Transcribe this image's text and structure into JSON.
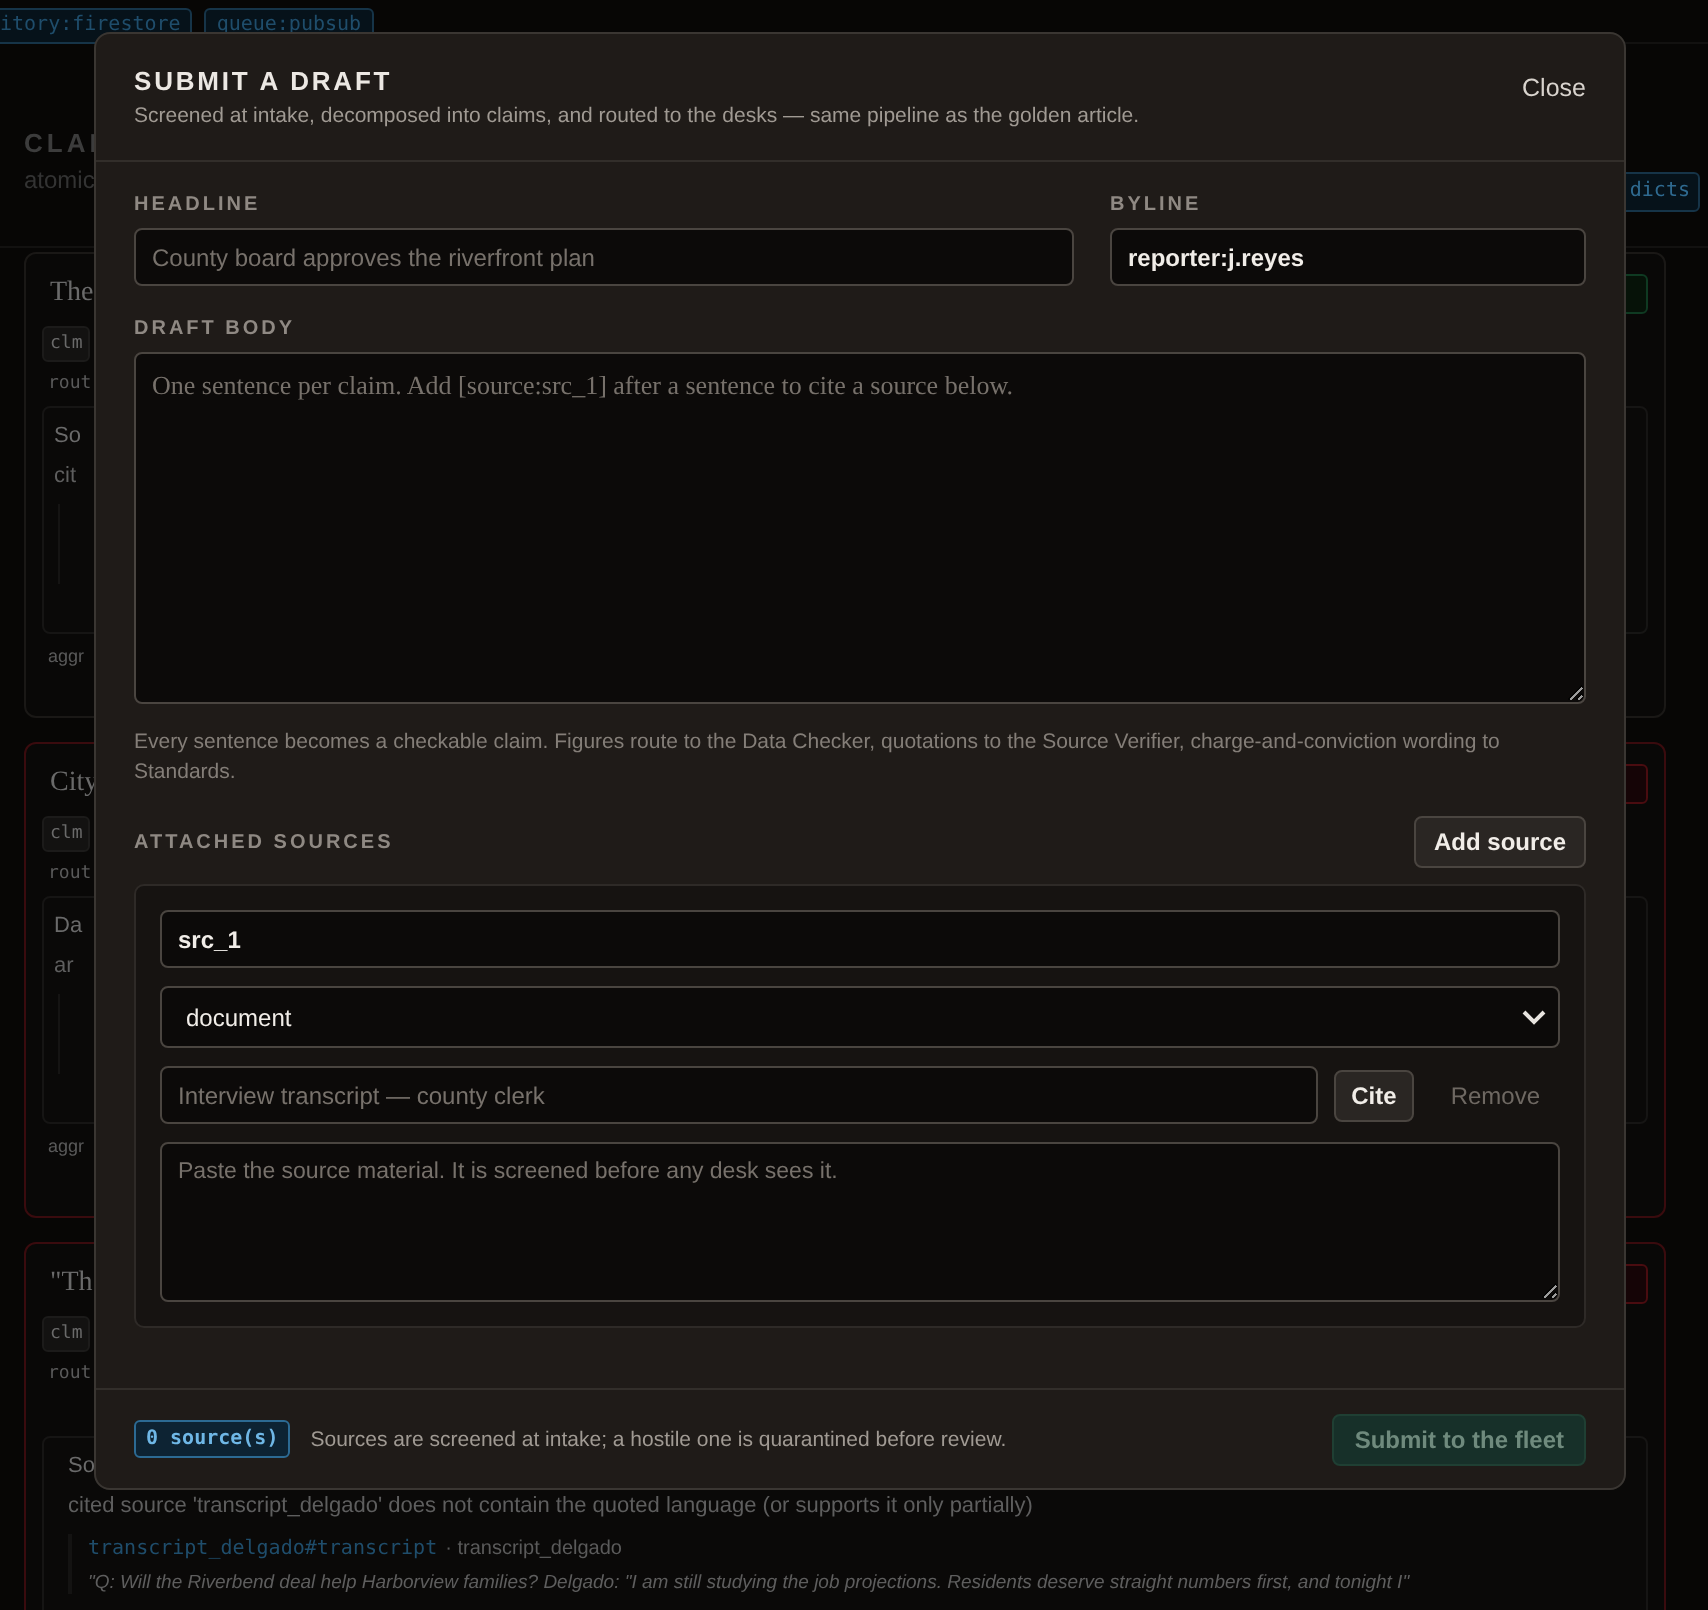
{
  "background": {
    "topbar_chips": [
      "itory:firestore",
      "queue:pubsub"
    ],
    "panel": {
      "title": "CLAI",
      "subtitle": "atomic",
      "chip": "dicts"
    },
    "cards": [
      {
        "title": "The",
        "tag": "clm",
        "route": "rout",
        "flagged": false,
        "block": {
          "title": "So",
          "lines": [
            "cit"
          ]
        },
        "footer": "aggr"
      },
      {
        "title": "City",
        "tag": "clm",
        "route": "rout",
        "flagged": true,
        "block": {
          "title": "Da",
          "lines": [
            "ar"
          ]
        },
        "footer": "aggr"
      },
      {
        "title": "\"Th",
        "tag": "clm",
        "route": "rout",
        "flagged": true,
        "block": {
          "title": "So",
          "lines": [
            "cited source 'transcript_delgado' does not contain the quoted language (or supports it only partially)"
          ],
          "ref": "transcript_delgado#transcript",
          "ref_source": "· transcript_delgado",
          "quote": "\"Q: Will the Riverbend deal help Harborview families? Delgado: \"I am still studying the job projections. Residents deserve straight numbers first, and tonight I\""
        }
      }
    ]
  },
  "modal": {
    "title": "SUBMIT A DRAFT",
    "subtitle": "Screened at intake, decomposed into claims, and routed to the desks — same pipeline as the golden article.",
    "close": "Close",
    "headline": {
      "label": "HEADLINE",
      "placeholder": "County board approves the riverfront plan"
    },
    "byline": {
      "label": "BYLINE",
      "value": "reporter:j.reyes"
    },
    "body": {
      "label": "DRAFT BODY",
      "placeholder": "One sentence per claim. Add [source:src_1] after a sentence to cite a source below.",
      "hint": "Every sentence becomes a checkable claim. Figures route to the Data Checker, quotations to the Source Verifier, charge-and-conviction wording to Standards."
    },
    "sources_label": "ATTACHED SOURCES",
    "add_source": "Add source",
    "sources": [
      {
        "id": "src_1",
        "type": "document",
        "title_placeholder": "Interview transcript — county clerk",
        "cite": "Cite",
        "remove": "Remove",
        "remove_disabled": true,
        "body_placeholder": "Paste the source material. It is screened before any desk sees it."
      }
    ],
    "footer": {
      "count": "0 source(s)",
      "note": "Sources are screened at intake; a hostile one is quarantined before review.",
      "submit": "Submit to the fleet",
      "submit_disabled": true
    }
  }
}
